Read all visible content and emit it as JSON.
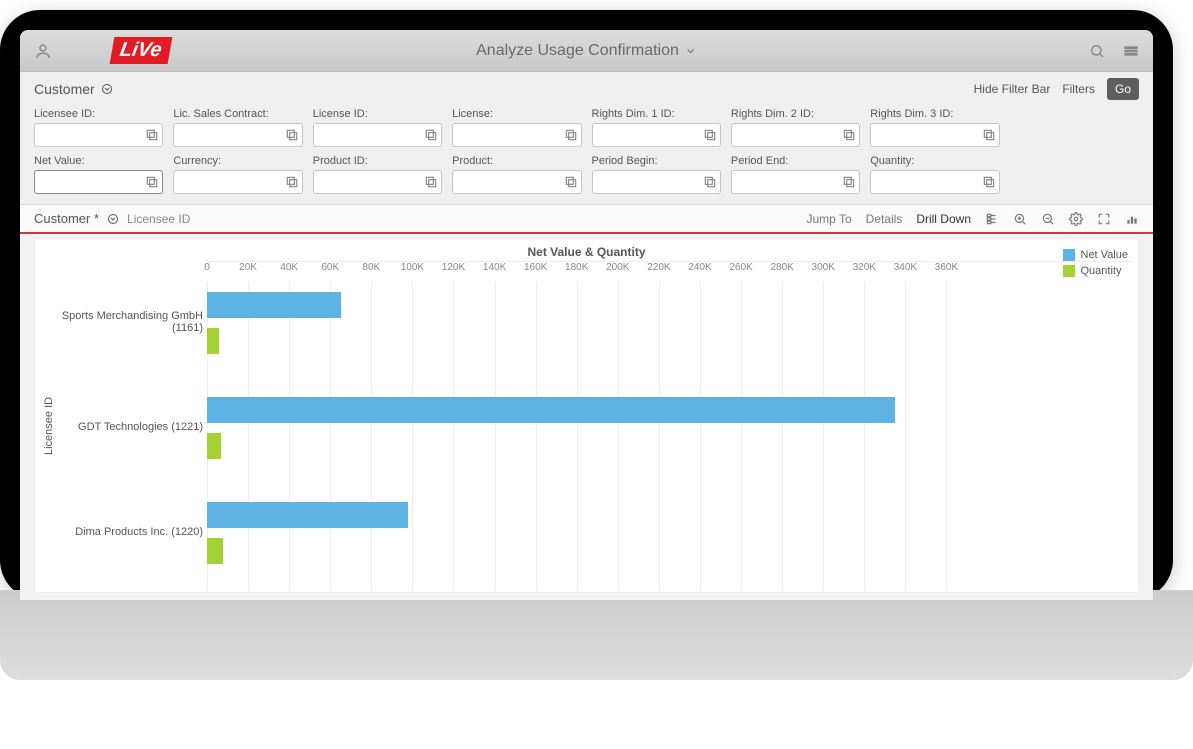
{
  "page_title": "Analyze Usage Confirmation",
  "logo_text": "LiVe",
  "filter_bar": {
    "heading": "Customer",
    "hide_label": "Hide Filter Bar",
    "filters_label": "Filters",
    "go_label": "Go",
    "fields_row1": [
      {
        "label": "Licensee ID:"
      },
      {
        "label": "Lic. Sales Contract:"
      },
      {
        "label": "License ID:"
      },
      {
        "label": "License:"
      },
      {
        "label": "Rights Dim. 1 ID:"
      },
      {
        "label": "Rights Dim. 2 ID:"
      },
      {
        "label": "Rights Dim. 3 ID:"
      }
    ],
    "fields_row2": [
      {
        "label": "Net Value:",
        "highlighted": true
      },
      {
        "label": "Currency:"
      },
      {
        "label": "Product ID:"
      },
      {
        "label": "Product:"
      },
      {
        "label": "Period Begin:"
      },
      {
        "label": "Period End:"
      },
      {
        "label": "Quantity:"
      }
    ]
  },
  "chart_toolbar": {
    "dim_selected": "Customer *",
    "dim_sub": "Licensee ID",
    "jump_to": "Jump To",
    "details": "Details",
    "drill_down": "Drill Down"
  },
  "chart_data": {
    "type": "bar",
    "orientation": "horizontal",
    "title": "Net Value & Quantity",
    "ylabel": "Licensee ID",
    "xlim": [
      0,
      370000
    ],
    "xticks": [
      0,
      20000,
      40000,
      60000,
      80000,
      100000,
      120000,
      140000,
      160000,
      180000,
      200000,
      220000,
      240000,
      260000,
      280000,
      300000,
      320000,
      340000,
      360000
    ],
    "xtick_labels": [
      "0",
      "20K",
      "40K",
      "60K",
      "80K",
      "100K",
      "120K",
      "140K",
      "160K",
      "180K",
      "200K",
      "220K",
      "240K",
      "260K",
      "280K",
      "300K",
      "320K",
      "340K",
      "360K"
    ],
    "categories": [
      "Sports Merchandising GmbH (1161)",
      "GDT Technologies (1221)",
      "Dima Products Inc. (1220)"
    ],
    "series": [
      {
        "name": "Net Value",
        "color": "#5cb3e4",
        "values": [
          65000,
          335000,
          98000
        ]
      },
      {
        "name": "Quantity",
        "color": "#a4d234",
        "values": [
          6000,
          7000,
          8000
        ]
      }
    ]
  }
}
